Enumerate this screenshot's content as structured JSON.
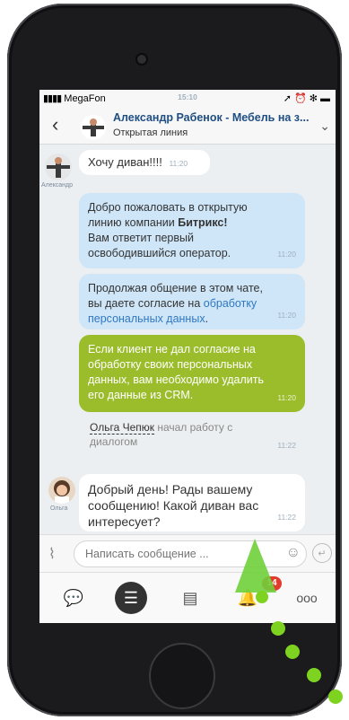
{
  "status": {
    "carrier": "MegaFon",
    "time": "15:10",
    "icons": "signal wifi battery"
  },
  "header": {
    "back": "‹",
    "title": "Александр Рабенок - Мебель на з...",
    "subtitle": "Открытая линия",
    "chevron": "⌄"
  },
  "messages": {
    "m1": {
      "author": "Александр",
      "text": "Хочу диван!!!!",
      "time": "11:20"
    },
    "m2": {
      "line1": "Добро пожаловать в открытую",
      "line2_pre": "линию компании ",
      "line2_bold": "Битрикс!",
      "line3": "Вам ответит первый",
      "line4": "освободившийся оператор.",
      "time": "11:20"
    },
    "m3": {
      "line1": "Продолжая общение в этом чате,",
      "line2_pre": "вы даете согласие на ",
      "line2_link": "обработку",
      "line3_link": "персональных данных",
      "line3_post": ".",
      "time": "11:20"
    },
    "m4": {
      "line1": "Если клиент не дал согласие на",
      "line2": "обработку своих персональных",
      "line3": "данных, вам необходимо удалить",
      "line4": "его данные из CRM.",
      "time": "11:20"
    },
    "sys": {
      "name": "Ольга Чепюк",
      "text1": " начал работу с",
      "text2": "диалогом",
      "time": "11:22"
    },
    "m5": {
      "author": "Ольга",
      "line1": "Добрый день! Рады вашему",
      "line2": "сообщению! Какой диван вас",
      "line3": "интересует?",
      "time": "11:22"
    }
  },
  "input": {
    "placeholder": "Написать сообщение ..."
  },
  "tabs": {
    "badge": "14"
  },
  "colors": {
    "accent_green": "#9bbd2b",
    "link_blue": "#2f78c1",
    "badge_red": "#e33b2b",
    "annotation_green": "#7ed321"
  }
}
